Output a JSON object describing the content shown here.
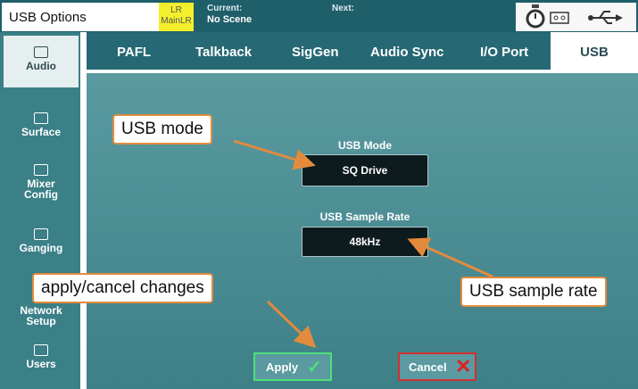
{
  "header": {
    "title": "USB Options",
    "mix_line1": "LR",
    "mix_line2": "MainLR",
    "current_label": "Current:",
    "current_value": "No Scene",
    "next_label": "Next:",
    "next_value": ""
  },
  "sidebar": {
    "items": [
      {
        "label": "Audio",
        "icon": "audio-icon",
        "selected": true
      },
      {
        "label": "Surface",
        "icon": "surface-icon"
      },
      {
        "label": "Mixer Config",
        "icon": "mixer-config-icon"
      },
      {
        "label": "Ganging",
        "icon": "ganging-icon"
      },
      {
        "label": "Network Setup",
        "icon": "network-icon"
      },
      {
        "label": "Users",
        "icon": "users-icon"
      }
    ]
  },
  "tabs": [
    "PAFL",
    "Talkback",
    "SigGen",
    "Audio Sync",
    "I/O Port",
    "USB"
  ],
  "active_tab": "USB",
  "usb_mode": {
    "label": "USB Mode",
    "value": "SQ Drive"
  },
  "sample_rate": {
    "label": "USB Sample Rate",
    "value": "48kHz"
  },
  "buttons": {
    "apply": "Apply",
    "cancel": "Cancel"
  },
  "callouts": {
    "usb_mode": "USB mode",
    "apply_cancel": "apply/cancel changes",
    "sample_rate": "USB sample rate"
  },
  "colors": {
    "callout_border": "#e38b3c",
    "apply_accent": "#4ee07a",
    "cancel_accent": "#e02020"
  }
}
